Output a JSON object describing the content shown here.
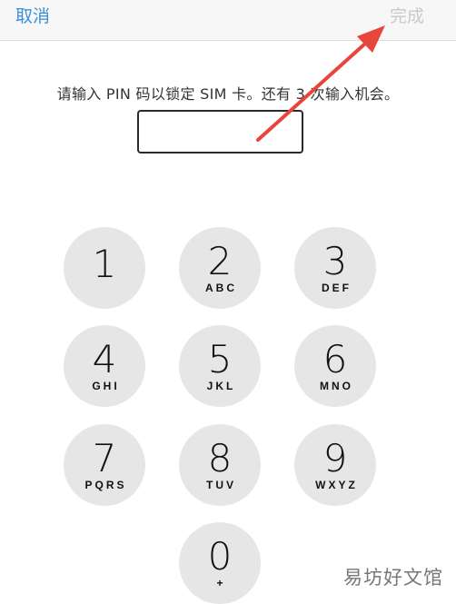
{
  "navbar": {
    "cancel_label": "取消",
    "done_label": "完成"
  },
  "prompt": "请输入 PIN 码以锁定 SIM 卡。还有 3 次输入机会。",
  "pin_input": {
    "value": ""
  },
  "keypad": [
    {
      "digit": "1",
      "letters": ""
    },
    {
      "digit": "2",
      "letters": "ABC"
    },
    {
      "digit": "3",
      "letters": "DEF"
    },
    {
      "digit": "4",
      "letters": "GHI"
    },
    {
      "digit": "5",
      "letters": "JKL"
    },
    {
      "digit": "6",
      "letters": "MNO"
    },
    {
      "digit": "7",
      "letters": "PQRS"
    },
    {
      "digit": "8",
      "letters": "TUV"
    },
    {
      "digit": "9",
      "letters": "WXYZ"
    },
    {
      "digit": "0",
      "letters": "+"
    }
  ],
  "watermark": "易坊好文馆",
  "annotation_color": "#e8453c"
}
